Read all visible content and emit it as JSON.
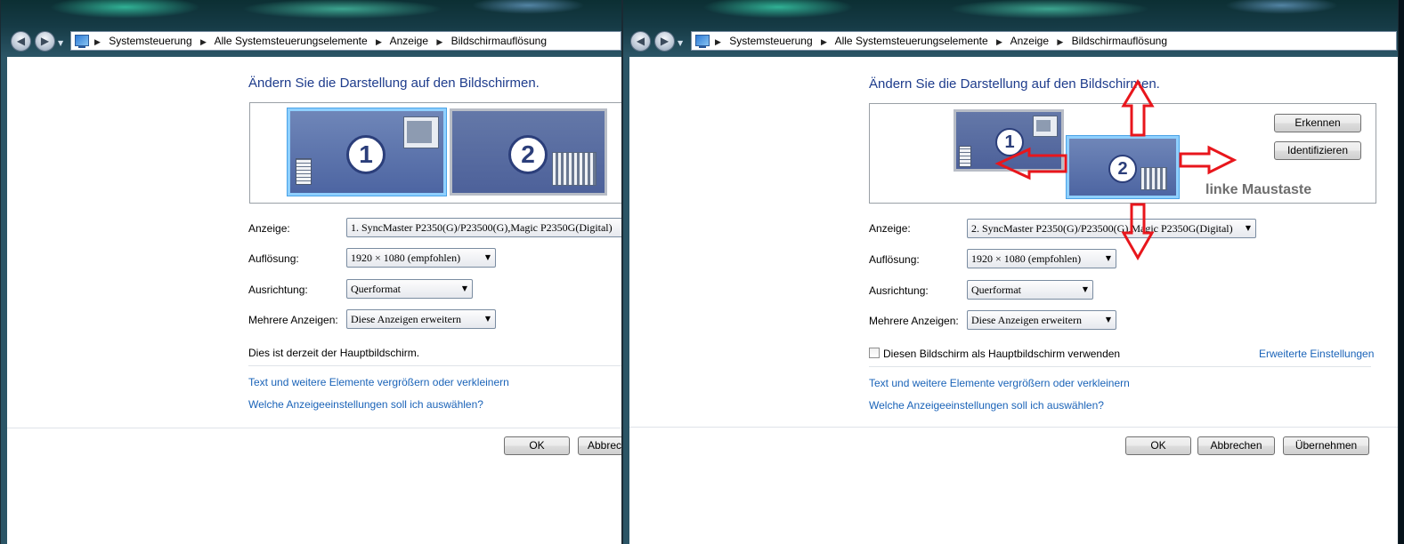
{
  "left": {
    "breadcrumb": [
      "Systemsteuerung",
      "Alle Systemsteuerungselemente",
      "Anzeige",
      "Bildschirmauflösung"
    ],
    "heading": "Ändern Sie die Darstellung auf den Bildschirmen.",
    "monitors": [
      {
        "number": "1",
        "selected": true
      },
      {
        "number": "2",
        "selected": false
      }
    ],
    "labels": {
      "anzeige": "Anzeige:",
      "aufloesung": "Auflösung:",
      "ausrichtung": "Ausrichtung:",
      "mehrere": "Mehrere Anzeigen:"
    },
    "values": {
      "anzeige": "1. SyncMaster P2350(G)/P23500(G),Magic P2350G(Digital)",
      "aufloesung": "1920 × 1080 (empfohlen)",
      "ausrichtung": "Querformat",
      "mehrere": "Diese Anzeigen erweitern"
    },
    "status_text": "Dies ist derzeit der Hauptbildschirm.",
    "links": [
      "Text und weitere Elemente vergrößern oder verkleinern",
      "Welche Anzeigeeinstellungen soll ich auswählen?"
    ],
    "buttons": {
      "ok": "OK",
      "cancel": "Abbrechen"
    }
  },
  "right": {
    "breadcrumb": [
      "Systemsteuerung",
      "Alle Systemsteuerungselemente",
      "Anzeige",
      "Bildschirmauflösung"
    ],
    "heading": "Ändern Sie die Darstellung auf den Bildschirmen.",
    "monitors": [
      {
        "number": "1",
        "selected": false
      },
      {
        "number": "2",
        "selected": true
      }
    ],
    "detect_button": "Erkennen",
    "identify_button": "Identifizieren",
    "annotation": "linke Maustaste",
    "labels": {
      "anzeige": "Anzeige:",
      "aufloesung": "Auflösung:",
      "ausrichtung": "Ausrichtung:",
      "mehrere": "Mehrere Anzeigen:"
    },
    "values": {
      "anzeige": "2. SyncMaster P2350(G)/P23500(G),Magic P2350G(Digital)",
      "aufloesung": "1920 × 1080 (empfohlen)",
      "ausrichtung": "Querformat",
      "mehrere": "Diese Anzeigen erweitern"
    },
    "checkbox_label": "Diesen Bildschirm als Hauptbildschirm verwenden",
    "checkbox_checked": false,
    "advanced_link": "Erweiterte Einstellungen",
    "links": [
      "Text und weitere Elemente vergrößern oder verkleinern",
      "Welche Anzeigeeinstellungen soll ich auswählen?"
    ],
    "buttons": {
      "ok": "OK",
      "cancel": "Abbrechen",
      "apply": "Übernehmen"
    }
  },
  "colors": {
    "heading": "#1e3c8c",
    "link": "#1a63b8",
    "annotation_arrow": "#e8161c",
    "selection_glow": "#8fd0ff"
  }
}
